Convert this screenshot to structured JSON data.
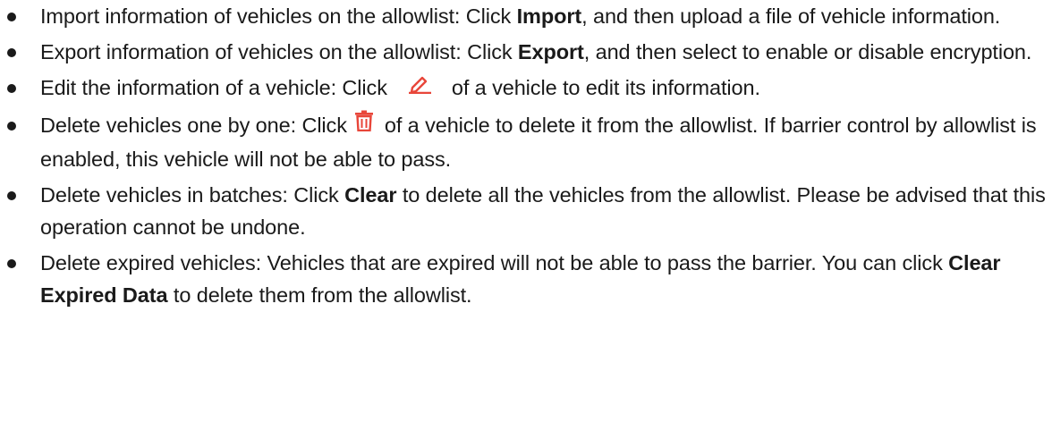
{
  "items": [
    {
      "before": "Import information of vehicles on the allowlist: Click ",
      "bold": "Import",
      "after": ", and then upload a file of vehicle information."
    },
    {
      "before": "Export information of vehicles on the allowlist: Click ",
      "bold": "Export",
      "after": ", and then select to enable or disable encryption."
    },
    {
      "before": "Edit the information of a vehicle: Click",
      "icon": "pencil-edit-icon",
      "after": "of a vehicle to edit its information."
    },
    {
      "before": "Delete vehicles one by one: Click",
      "icon": "trash-delete-icon",
      "after": "of a vehicle to delete it from the allowlist. If barrier control by allowlist is enabled, this vehicle will not be able to pass."
    },
    {
      "before": "Delete vehicles in batches: Click ",
      "bold": "Clear",
      "after": " to delete all the vehicles from the allowlist. Please be advised that this operation cannot be undone."
    },
    {
      "before": "Delete expired vehicles: Vehicles that are expired will not be able to pass the barrier. You can click ",
      "bold": "Clear Expired Data",
      "after": " to delete them from the allowlist."
    }
  ],
  "icon_color": "#e8463a"
}
